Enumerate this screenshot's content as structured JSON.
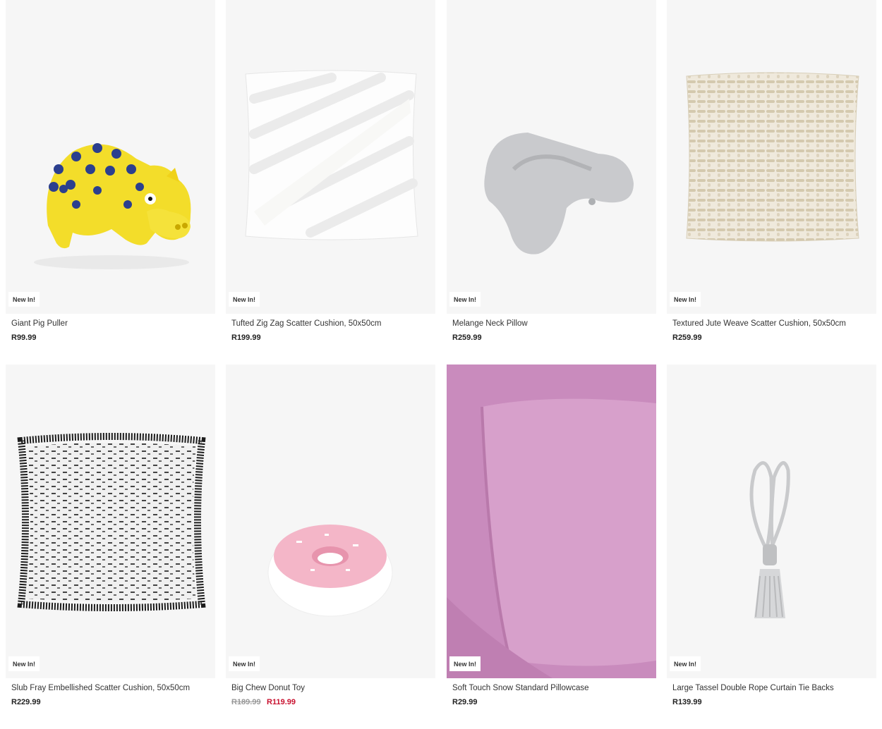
{
  "products": [
    {
      "name": "Giant Pig Puller",
      "badge": "New In!",
      "price": "R99.99"
    },
    {
      "name": "Tufted Zig Zag Scatter Cushion, 50x50cm",
      "badge": "New In!",
      "price": "R199.99"
    },
    {
      "name": "Melange Neck Pillow",
      "badge": "New In!",
      "price": "R259.99"
    },
    {
      "name": "Textured Jute Weave Scatter Cushion, 50x50cm",
      "badge": "New In!",
      "price": "R259.99"
    },
    {
      "name": "Slub Fray Embellished Scatter Cushion, 50x50cm",
      "badge": "New In!",
      "price": "R229.99"
    },
    {
      "name": "Big Chew Donut Toy",
      "badge": "New In!",
      "old_price": "R189.99",
      "sale_price": "R119.99"
    },
    {
      "name": "Soft Touch Snow Standard Pillowcase",
      "badge": "New In!",
      "price": "R29.99"
    },
    {
      "name": "Large Tassel Double Rope Curtain Tie Backs",
      "badge": "New In!",
      "price": "R139.99"
    }
  ],
  "colors": {
    "sale": "#c8102e",
    "tile_bg": "#f6f6f6",
    "pillowcase": "#c98bbd"
  }
}
